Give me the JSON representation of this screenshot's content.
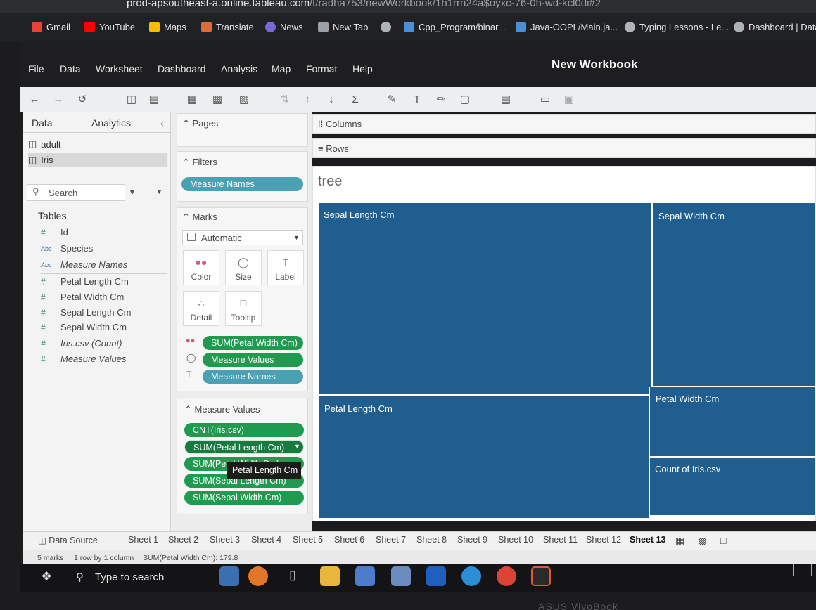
{
  "browser": {
    "url_host": "prod-apsoutheast-a.online.tableau.com",
    "url_path": "/t/radha753/newWorkbook/1h1rrn24a$oyxc-76-0h-wd-kcl0di#2",
    "bookmarks": [
      "Gmail",
      "YouTube",
      "Maps",
      "Translate",
      "News",
      "New Tab",
      "Cpp_Program/binar...",
      "Java-OOPL/Main.ja...",
      "Typing Lessons - Le...",
      "Dashboard | Data"
    ]
  },
  "app": {
    "workbook_title": "New Workbook",
    "menu": [
      "File",
      "Data",
      "Worksheet",
      "Dashboard",
      "Analysis",
      "Map",
      "Format",
      "Help"
    ]
  },
  "left_pane": {
    "tabs": [
      "Data",
      "Analytics"
    ],
    "datasources": [
      "adult",
      "Iris"
    ],
    "search_placeholder": "Search",
    "tables_header": "Tables",
    "fields": [
      {
        "type": "#",
        "name": "Id"
      },
      {
        "type": "Abc",
        "name": "Species"
      },
      {
        "type": "Abc",
        "name": "Measure Names"
      },
      {
        "type": "#",
        "name": "Petal Length Cm"
      },
      {
        "type": "#",
        "name": "Petal Width Cm"
      },
      {
        "type": "#",
        "name": "Sepal Length Cm"
      },
      {
        "type": "#",
        "name": "Sepal Width Cm"
      },
      {
        "type": "#",
        "name": "Iris.csv (Count)"
      },
      {
        "type": "#",
        "name": "Measure Values"
      }
    ]
  },
  "cards": {
    "pages": "Pages",
    "filters": "Filters",
    "filter_pill": "Measure Names",
    "marks": "Marks",
    "mark_type": "Automatic",
    "mark_buttons": [
      "Color",
      "Size",
      "Label",
      "Detail",
      "Tooltip"
    ],
    "mark_pills": [
      "SUM(Petal Width Cm)",
      "Measure Values",
      "Measure Names"
    ],
    "measure_values_title": "Measure Values",
    "measure_values": [
      "CNT(Iris.csv)",
      "SUM(Petal Length Cm)",
      "SUM(Petal Width Cm)",
      "SUM(Sepal Length Cm)",
      "SUM(Sepal Width Cm)"
    ],
    "tooltip": "Petal Length Cm"
  },
  "shelves": {
    "columns": "Columns",
    "rows": "Rows"
  },
  "view": {
    "title": "tree",
    "cells": [
      "Sepal Length Cm",
      "Sepal Width Cm",
      "Petal Length Cm",
      "Petal Width Cm",
      "Count of Iris.csv"
    ]
  },
  "sheet_tabs": {
    "data_source": "Data Source",
    "sheets": [
      "Sheet 1",
      "Sheet 2",
      "Sheet 3",
      "Sheet 4",
      "Sheet 5",
      "Sheet 6",
      "Sheet 7",
      "Sheet 8",
      "Sheet 9",
      "Sheet 10",
      "Sheet 11",
      "Sheet 12",
      "Sheet 13"
    ],
    "active": "Sheet 13"
  },
  "status": {
    "marks": "5 marks",
    "dims": "1 row by 1 column",
    "sum": "SUM(Petal Width Cm): 179.8"
  },
  "taskbar": {
    "search_placeholder": "Type to search"
  },
  "device": {
    "brand": "ASUS VivoBook"
  },
  "colors": {
    "treemap": "#1f5e8e",
    "pill_green": "#1f9a4e",
    "pill_blue": "#4aa1b4"
  }
}
